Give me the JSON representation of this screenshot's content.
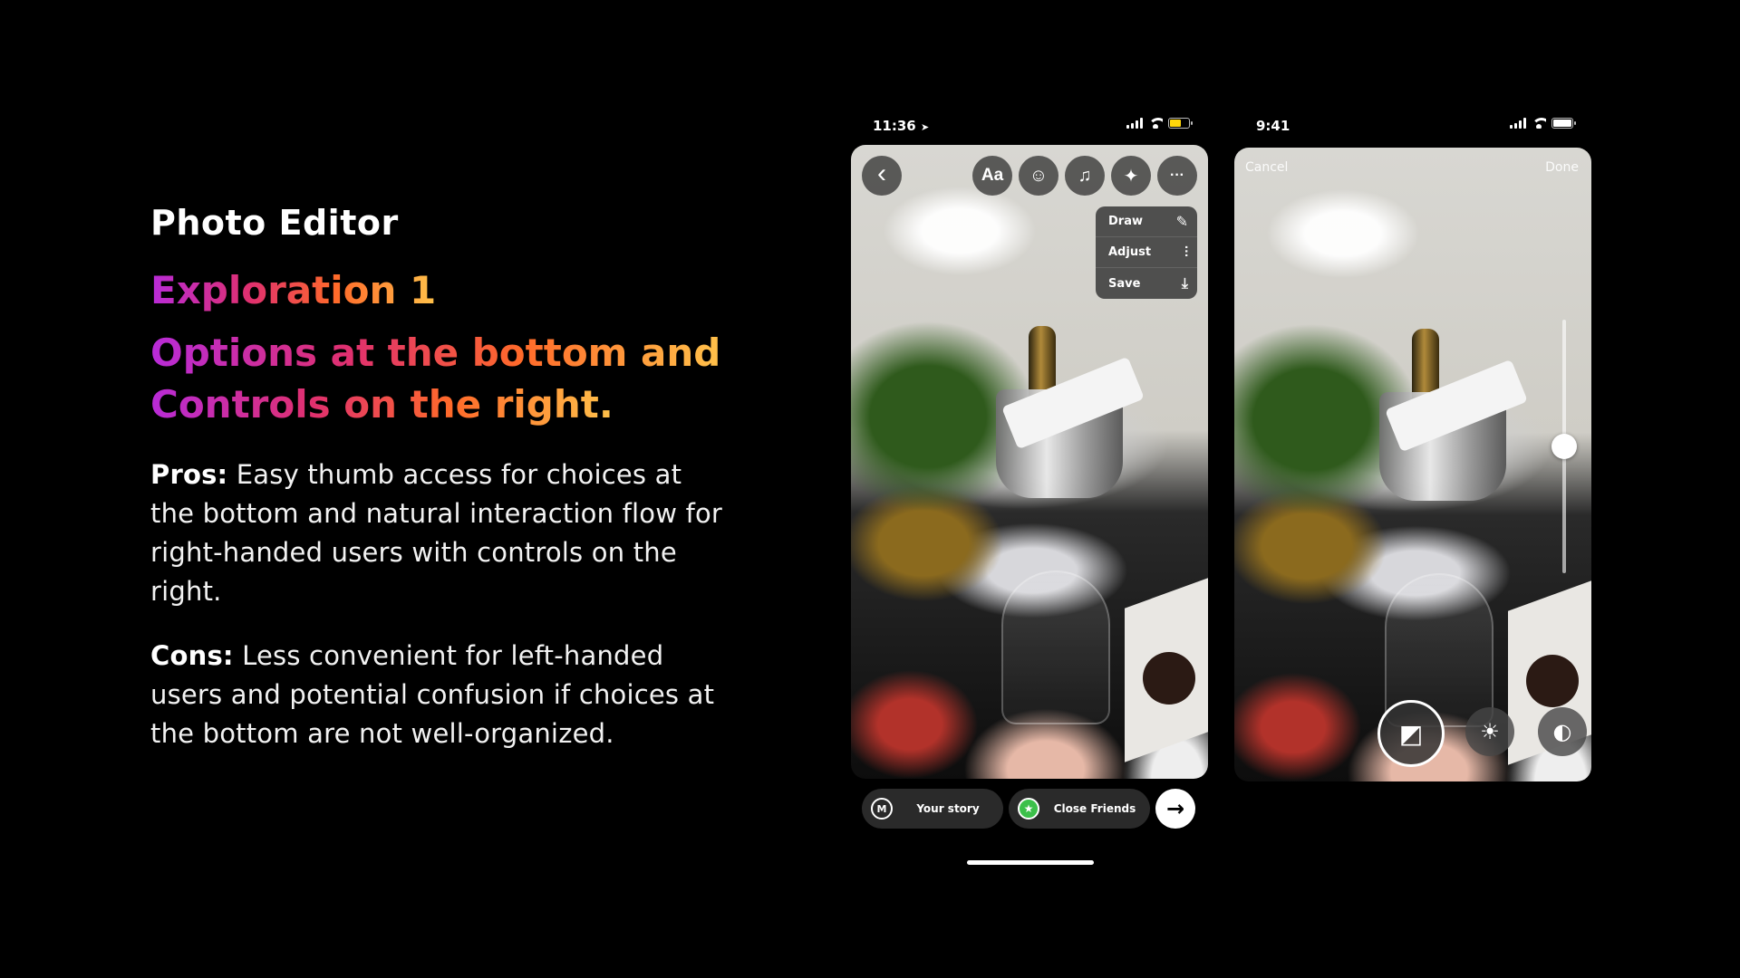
{
  "copy": {
    "kicker": "Photo Editor",
    "exploration": "Exploration 1",
    "headline_line1": "Options at the bottom and",
    "headline_line2": "Controls on the right.",
    "pros_label": "Pros:",
    "pros_text": " Easy thumb access for choices at the bottom and natural interaction flow for right-handed users with controls on the right.",
    "cons_label": "Cons:",
    "cons_text": " Less convenient for left-handed users and potential confusion if choices at the bottom are not well-organized."
  },
  "phone1": {
    "time": "11:36",
    "location_icon": "➤",
    "battery_color": "#ffd60a",
    "back_icon": "‹",
    "tools": {
      "text": "Aa",
      "sticker_icon": "☺",
      "music_icon": "♫",
      "effects_icon": "✦",
      "more_icon": "···"
    },
    "menu": [
      {
        "label": "Draw",
        "icon": "✎"
      },
      {
        "label": "Adjust",
        "icon": "⫶"
      },
      {
        "label": "Save",
        "icon": "⤓"
      }
    ],
    "share": {
      "avatar_text": "M",
      "your_story": "Your story",
      "close_friends_icon": "★",
      "close_friends": "Close Friends",
      "next_icon": "→"
    }
  },
  "phone2": {
    "time": "9:41",
    "battery_color": "#ffffff",
    "cancel": "Cancel",
    "done": "Done",
    "slider_value": 0.5,
    "controls": {
      "exposure_icon": "◩",
      "brightness_icon": "☀",
      "contrast_icon": "◐"
    }
  }
}
